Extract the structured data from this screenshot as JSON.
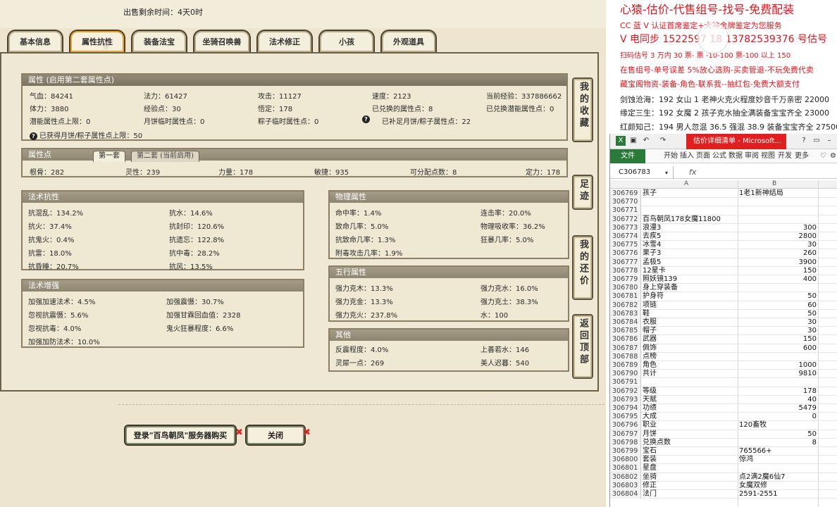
{
  "sale_time": {
    "label": "出售剩余时间：",
    "value": "4天0时"
  },
  "tabs": [
    "基本信息",
    "属性抗性",
    "装备法宝",
    "坐骑召唤兽",
    "法术修正",
    "小孩",
    "外观道具"
  ],
  "active_tab": 1,
  "attr_panel": {
    "title": "属性 (启用第二套属性点)",
    "rows": [
      [
        "气血：84241",
        "法力：61427",
        "攻击：11127",
        "速度：2123",
        "当前经验：337886662"
      ],
      [
        "体力：3880",
        "经验点：30",
        "悟定：178",
        "已兑换的属性点：8",
        "已兑换潜能属性点：0"
      ],
      [
        "潜能属性点上限：0",
        "月饼临时属性点：0",
        "粽子临时属性点：0",
        "已补足月饼/粽子属性点：22",
        ""
      ]
    ],
    "footer": "已获得月饼/粽子属性点上限：50"
  },
  "points_panel": {
    "title": "属性点",
    "subtabs": [
      "第一套",
      "第二套 (当前启用)"
    ],
    "row": [
      "根骨：282",
      "灵性：239",
      "力量：178",
      "敏捷：935",
      "可分配点数：8",
      "定力：178"
    ]
  },
  "magic_resist": {
    "title": "法术抗性",
    "left": [
      "抗混乱：134.2%",
      "抗火：37.4%",
      "抗鬼火：0.4%",
      "抗雷：18.0%",
      "抗昏睡：20.7%"
    ],
    "right": [
      "抗水：14.6%",
      "抗封印：120.6%",
      "抗遗忘：122.8%",
      "抗中毒：28.2%",
      "抗风：13.5%"
    ]
  },
  "magic_boost": {
    "title": "法术增强",
    "left": [
      "加强加速法术：4.5%",
      "忽视抗震慑：5.6%",
      "忽视抗毒：4.0%",
      "加强加防法术：10.0%"
    ],
    "right": [
      "加强震慑：30.7%",
      "加强甘霖回血值：2328",
      "鬼火狂暴程度：6.6%"
    ]
  },
  "physical": {
    "title": "物理属性",
    "left": [
      "命中率：1.4%",
      "致命几率：5.0%",
      "抗致命几率：1.3%",
      "附毒攻击几率：1.9%"
    ],
    "right": [
      "连击率：20.0%",
      "物理吸收率：36.2%",
      "狂暴几率：5.0%"
    ]
  },
  "elements": {
    "title": "五行属性",
    "left": [
      "强力克木：13.3%",
      "强力克金：13.3%",
      "强力克火：237.8%"
    ],
    "right": [
      "强力克水：16.0%",
      "强力克土：38.3%",
      "水：100"
    ]
  },
  "other": {
    "title": "其他",
    "left": [
      "反震程度：4.0%",
      "灵犀一点：269"
    ],
    "right": [
      "上善若水：146",
      "美人迟暮：540"
    ]
  },
  "side_buttons": [
    "我的收藏",
    "足迹",
    "我的还价",
    "返回顶部"
  ],
  "bottom_buttons": {
    "buy": "登录\"百鸟朝凤\"服务器购买",
    "close": "关闭"
  },
  "ad": {
    "line1": "心猿-估价-代售组号-找号-免费配装",
    "line2": "CC 蓝 V 认证首席鉴定+大神金牌鉴定为您服务",
    "line3": "V 电同步 1522597  18  13782539376  号估号",
    "line4": "扫码估号 3 万内 30 票-    票 -10-100 票-100 以上 150",
    "line5": "在售组号-单号误差 5%放心选购-买卖管退-不玩免费代卖",
    "line6": "藏宝阁物资-装备-角色-联系我--抽红包-免费大额支付",
    "line7": "剑蚀沧海：192 女山 1 老神火克火程度妙音千万亲密 22000",
    "line8": "缘定三生：192 女魔 2 孩子克水抽全满装备宝宝齐全 23000",
    "line9": "红颜知己：194 男人忽混 36.5 强混 38.9 装备宝宝齐全 27500"
  },
  "excel": {
    "title": "估价详细清单 - Microsoft...",
    "menu": [
      "文件",
      "开始",
      "插入",
      "页面",
      "公式",
      "数据",
      "审阅",
      "视图",
      "开发",
      "更多"
    ],
    "namebox": "C306783",
    "fx": "fx",
    "col_a": "A",
    "col_b": "B",
    "rows": [
      [
        "306769",
        "孩子",
        "1老1新神结局"
      ],
      [
        "306770",
        "",
        ""
      ],
      [
        "306771",
        "",
        ""
      ],
      [
        "306772",
        "百鸟朝凤178女魔11800",
        ""
      ],
      [
        "306773",
        "浪漫3",
        "300"
      ],
      [
        "306774",
        "去疾5",
        "2800"
      ],
      [
        "306775",
        "冰雪4",
        "30"
      ],
      [
        "306776",
        "果子3",
        "260"
      ],
      [
        "306777",
        "孟极5",
        "3900"
      ],
      [
        "306778",
        "12星卡",
        "150"
      ],
      [
        "306779",
        "照妖镜139",
        "400"
      ],
      [
        "306780",
        "身上穿装备",
        ""
      ],
      [
        "306781",
        "护身符",
        "50"
      ],
      [
        "306782",
        "项链",
        "60"
      ],
      [
        "306783",
        "鞋",
        "50"
      ],
      [
        "306784",
        "衣服",
        "30"
      ],
      [
        "306785",
        "帽子",
        "30"
      ],
      [
        "306786",
        "武器",
        "150"
      ],
      [
        "306787",
        "佩饰",
        "600"
      ],
      [
        "306788",
        "点榜",
        ""
      ],
      [
        "306789",
        "角色",
        "1000"
      ],
      [
        "306790",
        "共计",
        "9810"
      ],
      [
        "306791",
        "",
        ""
      ],
      [
        "306792",
        "等级",
        "178"
      ],
      [
        "306793",
        "天赋",
        "40"
      ],
      [
        "306794",
        "功绩",
        "5479"
      ],
      [
        "306795",
        "大成",
        "0"
      ],
      [
        "306796",
        "职业",
        "120畜牧"
      ],
      [
        "306797",
        "月饼",
        "50"
      ],
      [
        "306798",
        "兑换点数",
        "8"
      ],
      [
        "306799",
        "宝石",
        "765566+"
      ],
      [
        "306800",
        "套装",
        "惊鸿"
      ],
      [
        "306801",
        "星盘",
        ""
      ],
      [
        "306802",
        "坐骑",
        "点2满2魔6仙7"
      ],
      [
        "306803",
        "修正",
        "女魔双修"
      ],
      [
        "306804",
        "法门",
        "2591-2551"
      ]
    ]
  }
}
